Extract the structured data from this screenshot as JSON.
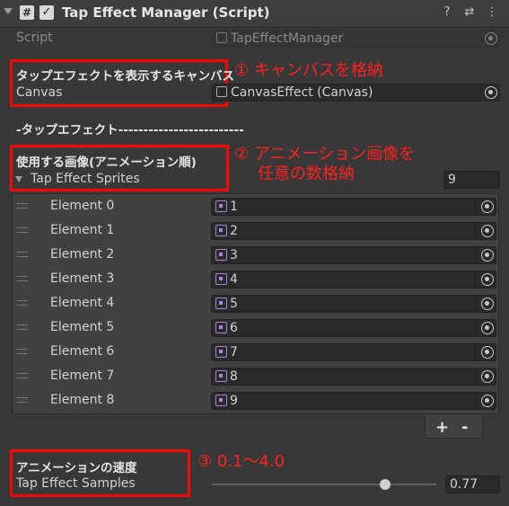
{
  "header": {
    "title": "Tap Effect Manager (Script)",
    "script_icon": "#",
    "check": "✓",
    "help_icon": "?",
    "settings_icon": "⇄",
    "more_icon": "⋮"
  },
  "script_row": {
    "label": "Script",
    "value": "TapEffectManager"
  },
  "canvas_section": {
    "header": "タップエフェクトを表示するキャンバス",
    "label": "Canvas",
    "value": "CanvasEffect (Canvas)"
  },
  "tap_effect_header": "-タップエフェクト-------------------------",
  "sprites_section": {
    "header": "使用する画像(アニメーション順)",
    "label": "Tap Effect Sprites",
    "size": "9",
    "elements": [
      {
        "label": "Element 0",
        "value": "1"
      },
      {
        "label": "Element 1",
        "value": "2"
      },
      {
        "label": "Element 2",
        "value": "3"
      },
      {
        "label": "Element 3",
        "value": "4"
      },
      {
        "label": "Element 4",
        "value": "5"
      },
      {
        "label": "Element 5",
        "value": "6"
      },
      {
        "label": "Element 6",
        "value": "7"
      },
      {
        "label": "Element 7",
        "value": "8"
      },
      {
        "label": "Element 8",
        "value": "9"
      }
    ],
    "add_label": "+",
    "remove_label": "-"
  },
  "speed_section": {
    "header": "アニメーションの速度",
    "label": "Tap Effect Samples",
    "value": "0.77",
    "slider_fraction": 0.77
  },
  "annotations": {
    "a1": "① キャンバスを格納",
    "a2_line1": "② アニメーション画像を",
    "a2_line2": "任意の数格納",
    "a3": "③ 0.1～4.0"
  },
  "colors": {
    "background": "#383838",
    "annotation": "#ff0000",
    "sprite_icon": "#a686d8"
  }
}
